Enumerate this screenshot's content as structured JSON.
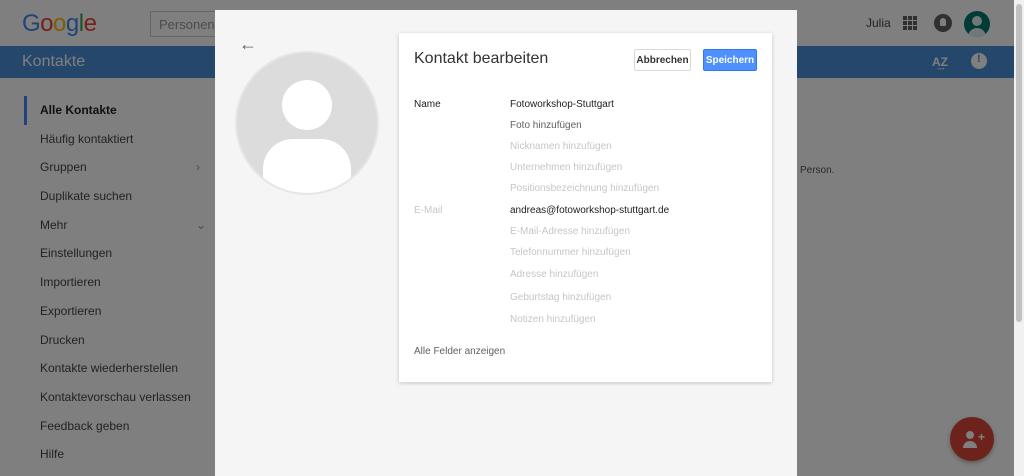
{
  "header": {
    "logo": [
      "G",
      "o",
      "o",
      "g",
      "l",
      "e"
    ],
    "search_placeholder": "Personen s",
    "user_name": "Julia"
  },
  "appbar": {
    "title": "Kontakte",
    "sort_label": "A͢Z"
  },
  "nav": [
    {
      "label": "Alle Kontakte",
      "active": true
    },
    {
      "label": "Häufig kontaktiert"
    },
    {
      "label": "Gruppen",
      "chevron": "›"
    },
    {
      "label": "Duplikate suchen"
    },
    {
      "label": "Mehr",
      "chevron": "⌄"
    },
    {
      "label": "Einstellungen"
    },
    {
      "label": "Importieren"
    },
    {
      "label": "Exportieren"
    },
    {
      "label": "Drucken"
    },
    {
      "label": "Kontakte wiederherstellen"
    },
    {
      "label": "Kontaktevorschau verlassen"
    },
    {
      "label": "Feedback geben"
    },
    {
      "label": "Hilfe"
    }
  ],
  "background_text": "Person.",
  "fab_plus": "+",
  "dialog": {
    "back_arrow": "←",
    "title": "Kontakt bearbeiten",
    "cancel_label": "Abbrechen",
    "save_label": "Speichern",
    "name_label": "Name",
    "name_value": "Fotoworkshop-Stuttgart",
    "photo_link": "Foto hinzufügen",
    "nickname_placeholder": "Nicknamen hinzufügen",
    "company_placeholder": "Unternehmen hinzufügen",
    "position_placeholder": "Positionsbezeichnung hinzufügen",
    "email_label": "E-Mail",
    "email_value": "andreas@fotoworkshop-stuttgart.de",
    "email_add_placeholder": "E-Mail-Adresse hinzufügen",
    "phone_placeholder": "Telefonnummer hinzufügen",
    "address_placeholder": "Adresse hinzufügen",
    "birthday_placeholder": "Geburtstag hinzufügen",
    "notes_placeholder": "Notizen hinzufügen",
    "show_all_label": "Alle Felder anzeigen"
  },
  "colors": {
    "accent": "#4285f4",
    "appbar": "#4b8fd6",
    "save": "#4d90fe",
    "fab": "#db4437"
  }
}
